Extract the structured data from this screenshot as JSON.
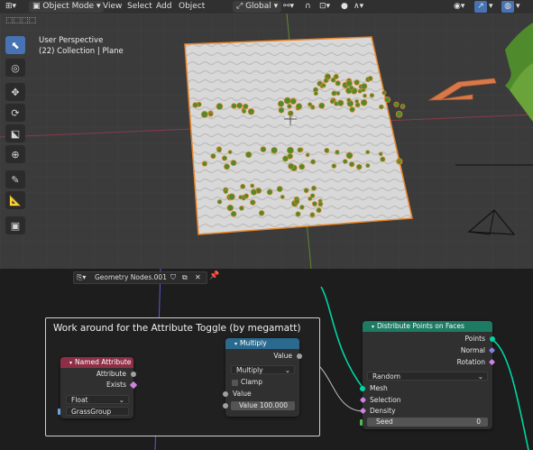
{
  "header": {
    "mode": "Object Mode",
    "menus": [
      "View",
      "Select",
      "Add",
      "Object"
    ],
    "orientation": "Global"
  },
  "viewport": {
    "title": "User Perspective",
    "subtitle": "(22) Collection | Plane"
  },
  "node_editor": {
    "tree_name": "Geometry Nodes.001"
  },
  "frame": {
    "label": "Work around for the  Attribute Toggle (by megamatt)"
  },
  "named_attribute": {
    "title": "Named Attribute",
    "outputs": [
      "Attribute",
      "Exists"
    ],
    "type": "Float",
    "name": "GrassGroup"
  },
  "multiply": {
    "title": "Multiply",
    "output": "Value",
    "operation": "Multiply",
    "clamp": "Clamp",
    "input": "Value",
    "value_label": "Value",
    "value": "100.000"
  },
  "distribute": {
    "title": "Distribute Points on Faces",
    "outputs": [
      "Points",
      "Normal",
      "Rotation"
    ],
    "method": "Random",
    "inputs": [
      "Mesh",
      "Selection",
      "Density"
    ],
    "seed_label": "Seed",
    "seed_value": "0"
  },
  "colors": {
    "attribute_header": "#8e2f47",
    "math_header": "#2b6a8f",
    "geometry_header": "#1d7a63",
    "geometry_socket": "#00d6a3",
    "float_socket": "#a1a1a1",
    "field_socket": "#cc84e0",
    "link": "#00d6a3"
  }
}
